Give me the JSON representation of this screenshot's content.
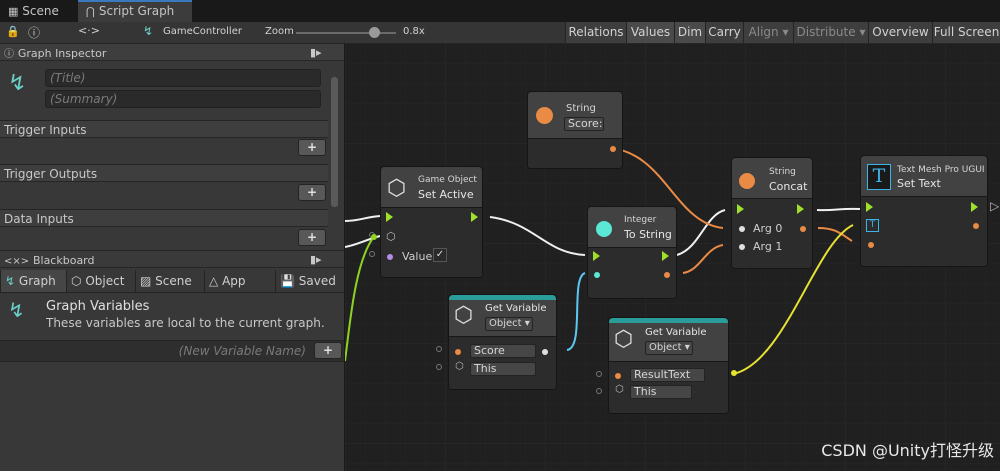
{
  "tabs": {
    "scene": "Scene",
    "script_graph": "Script Graph"
  },
  "toolbar": {
    "graph_name": "GameController",
    "zoom_label": "Zoom",
    "zoom_value": "0.8x",
    "zoom_level": 0.8,
    "buttons": [
      "Relations",
      "Values",
      "Dim",
      "Carry",
      "Align ▾",
      "Distribute ▾",
      "Overview",
      "Full Screen"
    ]
  },
  "inspector": {
    "title": "Graph Inspector",
    "title_placeholder": "(Title)",
    "summary_placeholder": "(Summary)",
    "sections": [
      "Trigger Inputs",
      "Trigger Outputs",
      "Data Inputs"
    ]
  },
  "blackboard": {
    "title": "Blackboard",
    "tabs": [
      "Graph",
      "Object",
      "Scene",
      "App",
      "Saved"
    ],
    "heading": "Graph Variables",
    "description": "These variables are local to the current graph.",
    "new_var_placeholder": "(New Variable Name)"
  },
  "nodes": {
    "set_active": {
      "category": "Game Object",
      "name": "Set Active",
      "value_label": "Value"
    },
    "string": {
      "category": "String",
      "value": "Score:"
    },
    "to_string": {
      "category": "Integer",
      "name": "To String"
    },
    "concat": {
      "category": "String",
      "name": "Concat",
      "arg0": "Arg 0",
      "arg1": "Arg 1"
    },
    "set_text": {
      "category": "Text Mesh Pro UGUI",
      "name": "Set Text"
    },
    "get_var_1": {
      "title": "Get Variable",
      "kind": "Object ▾",
      "var": "Score",
      "target": "This"
    },
    "get_var_2": {
      "title": "Get Variable",
      "kind": "Object ▾",
      "var": "ResultText",
      "target": "This"
    }
  },
  "watermark": "CSDN @Unity打怪升级",
  "colors": {
    "flow": "#9ee02a",
    "string": "#e98a45",
    "integer": "#5bc8f0",
    "object": "#e6e232",
    "teal": "#2a9c9a"
  }
}
